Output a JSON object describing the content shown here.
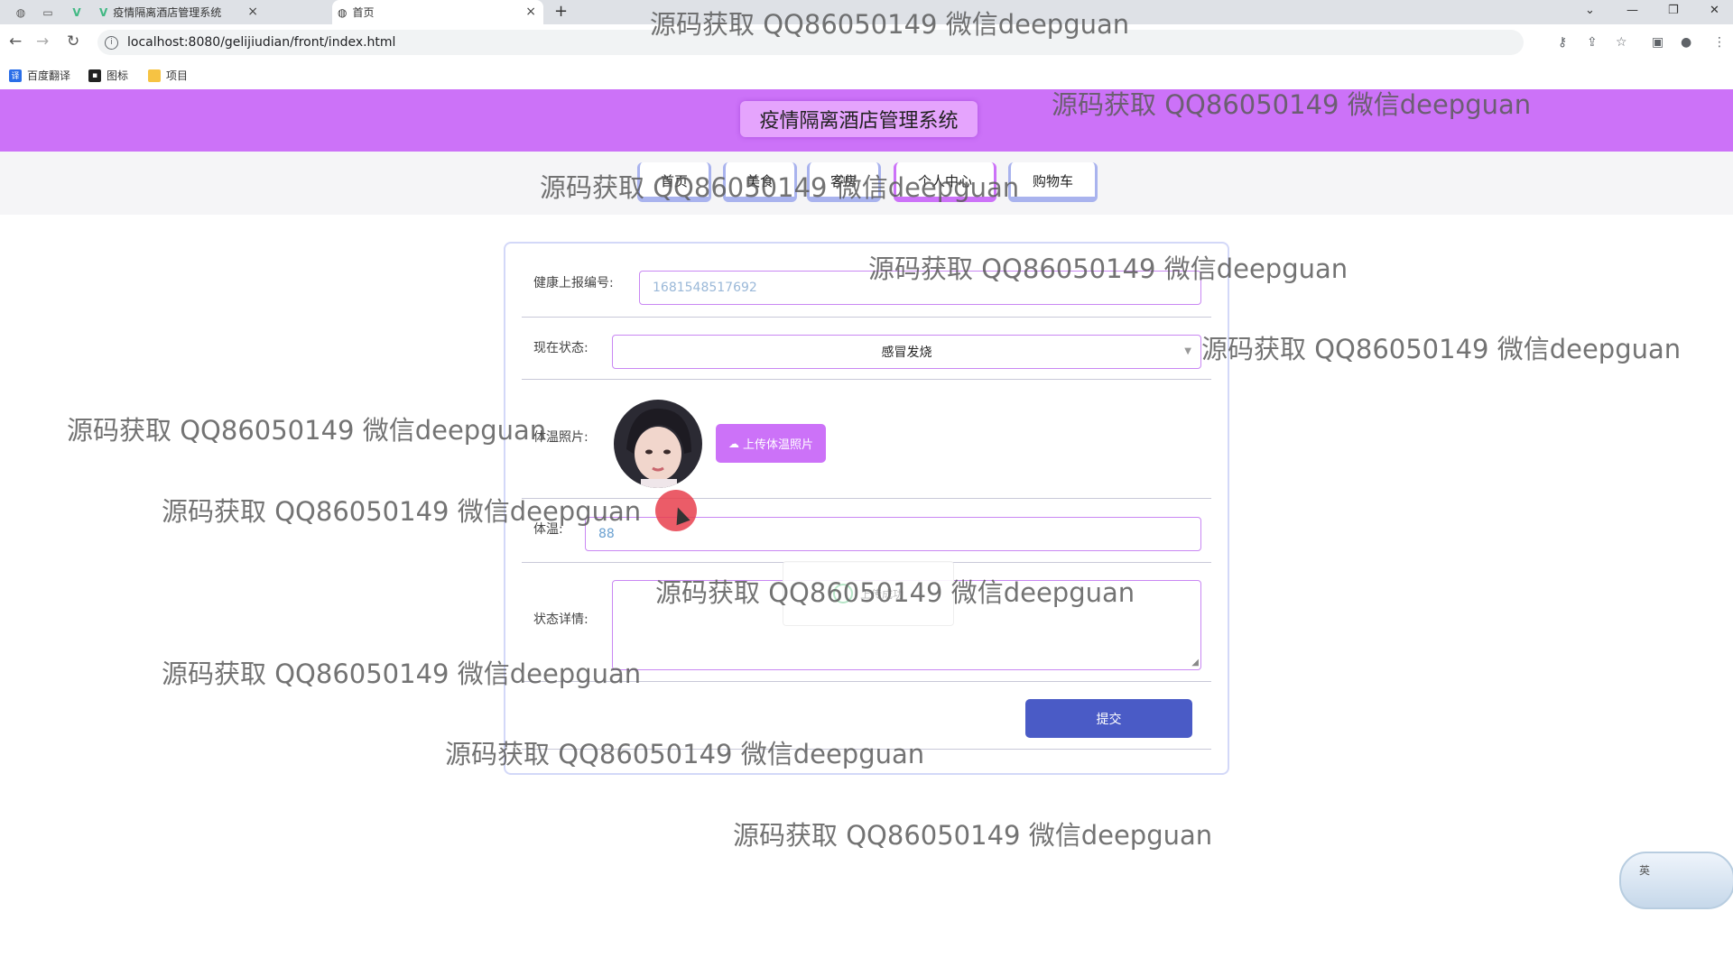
{
  "browser": {
    "tabs": [
      {
        "title": "疫情隔离酒店管理系统",
        "close": "×"
      },
      {
        "title": "首页",
        "close": "×",
        "active": true
      }
    ],
    "new_tab": "+",
    "url": "localhost:8080/gelijiudian/front/index.html",
    "bookmarks": [
      "百度翻译",
      "图标",
      "项目"
    ]
  },
  "site": {
    "title": "疫情隔离酒店管理系统",
    "nav": [
      "首页",
      "美食",
      "客房",
      "个人中心",
      "购物车"
    ],
    "active_nav": "个人中心"
  },
  "form": {
    "report_no_label": "健康上报编号:",
    "report_no_value": "1681548517692",
    "status_label": "现在状态:",
    "status_value": "感冒发烧",
    "photo_label": "体温照片:",
    "upload_label": "上传体温照片",
    "temp_label": "体温:",
    "temp_value": "88",
    "detail_label": "状态详情:",
    "toast_text": "上传成功",
    "submit_label": "提交"
  },
  "widget": {
    "ime": "英"
  },
  "watermark": "源码获取 QQ86050149 微信deepguan",
  "colors": {
    "header": "#cc72f8",
    "submit": "#4a5bc6",
    "accent": "#c987f3"
  }
}
